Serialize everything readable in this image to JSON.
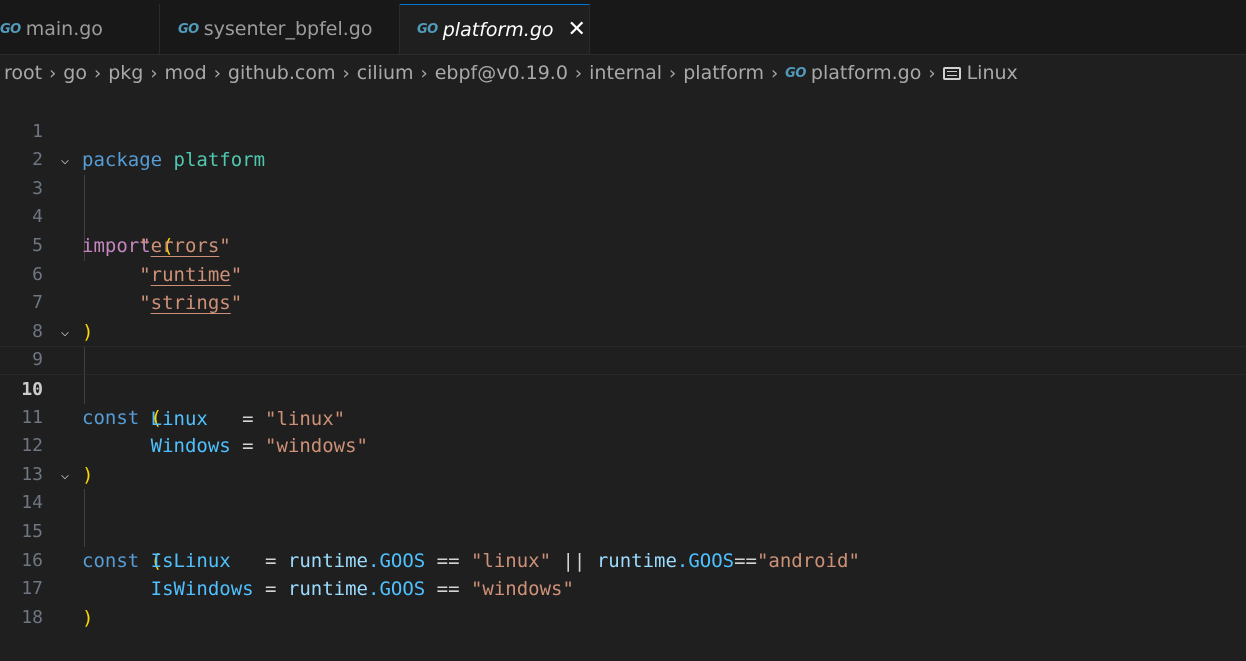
{
  "tabs": [
    {
      "label": "main.go",
      "icon": "go-icon",
      "active": false
    },
    {
      "label": "sysenter_bpfel.go",
      "icon": "go-icon",
      "active": false
    },
    {
      "label": "platform.go",
      "icon": "go-icon",
      "active": true
    }
  ],
  "tab_icon_text": "GO",
  "tab_close_glyph": "✕",
  "breadcrumb": [
    "root",
    "go",
    "pkg",
    "mod",
    "github.com",
    "cilium",
    "ebpf@v0.19.0",
    "internal",
    "platform",
    "platform.go",
    "Linux"
  ],
  "breadcrumb_separator": "›",
  "editor": {
    "current_line": 10,
    "line_numbers": [
      "1",
      "2",
      "3",
      "4",
      "5",
      "6",
      "7",
      "8",
      "9",
      "10",
      "11",
      "12",
      "13",
      "14",
      "15",
      "16",
      "17",
      "18"
    ],
    "code": {
      "l1_package": "package",
      "l1_name": "platform",
      "l3_import": "import",
      "l3_paren": "(",
      "l4_q1": "\"",
      "l4_val": "errors",
      "l4_q2": "\"",
      "l5_q1": "\"",
      "l5_val": "runtime",
      "l5_q2": "\"",
      "l6_q1": "\"",
      "l6_val": "strings",
      "l6_q2": "\"",
      "l7_paren": ")",
      "l9_const": "const",
      "l9_paren": "(",
      "l10_name": "Linux",
      "l10_eq": "   = ",
      "l10_val": "\"linux\"",
      "l11_name": "Windows",
      "l11_eq": " = ",
      "l11_val": "\"windows\"",
      "l12_paren": ")",
      "l14_const": "const",
      "l14_paren": "(",
      "l15_name": "IsLinux",
      "l15_eq": "   = ",
      "l15_rt1": "runtime",
      "l15_goos1": ".GOOS",
      "l15_op1": " == ",
      "l15_s1": "\"linux\"",
      "l15_or": " || ",
      "l15_rt2": "runtime",
      "l15_goos2": ".GOOS",
      "l15_op2": "==",
      "l15_s2": "\"android\"",
      "l16_name": "IsWindows",
      "l16_eq": " = ",
      "l16_rt": "runtime",
      "l16_goos": ".GOOS",
      "l16_op": " == ",
      "l16_s": "\"windows\"",
      "l17_paren": ")"
    }
  },
  "colors": {
    "background": "#1f1f1f",
    "keyword_blue": "#569cd6",
    "keyword_purple": "#c586c0",
    "string": "#ce9178",
    "constant": "#4fc1ff",
    "bracket": "#ffd700",
    "package_name": "#4ec9b0"
  }
}
